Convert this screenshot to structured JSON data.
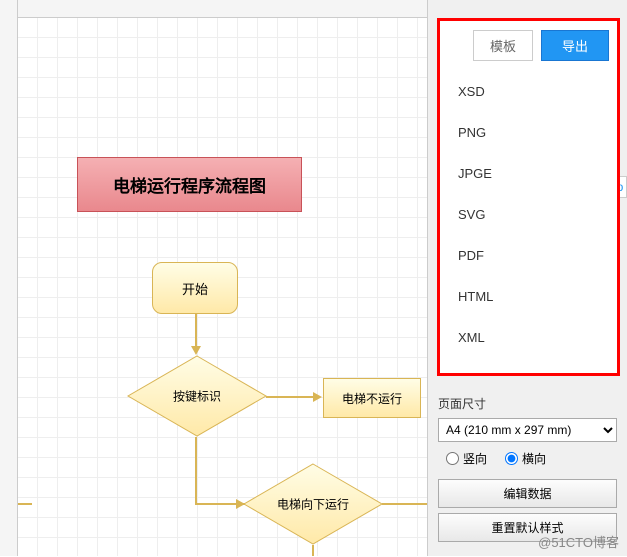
{
  "toolbar": {
    "template_label": "模板",
    "export_label": "导出"
  },
  "export_menu": {
    "items": [
      "XSD",
      "PNG",
      "JPGE",
      "SVG",
      "PDF",
      "HTML",
      "XML"
    ]
  },
  "flowchart": {
    "title": "电梯运行程序流程图",
    "start": "开始",
    "keypress": "按键标识",
    "norun": "电梯不运行",
    "down": "电梯向下运行"
  },
  "panel": {
    "page_size_label": "页面尺寸",
    "page_size_value": "A4 (210 mm x 297 mm)",
    "orientation_portrait": "竖向",
    "orientation_landscape": "横向",
    "edit_data": "编辑数据",
    "reset_style": "重置默认样式"
  },
  "badge": "p",
  "watermark": "@51CTO博客"
}
